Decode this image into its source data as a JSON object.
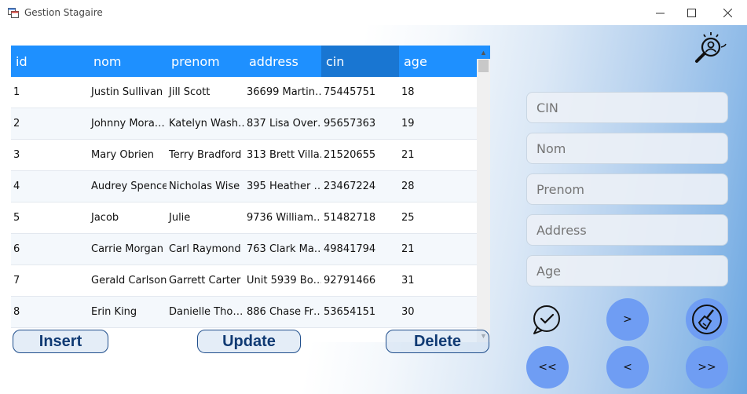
{
  "window": {
    "title": "Gestion Stagaire",
    "minimize_glyph": "—",
    "maximize_glyph": "☐",
    "close_glyph": "✕"
  },
  "grid": {
    "columns": [
      "id",
      "nom",
      "prenom",
      "address",
      "cin",
      "age"
    ],
    "rows": [
      [
        "1",
        "Justin Sullivan",
        "Jill Scott",
        "36699 Martin…",
        "75445751",
        "18"
      ],
      [
        "2",
        "Johnny Mora…",
        "Katelyn Wash…",
        "837 Lisa Over…",
        "95657363",
        "19"
      ],
      [
        "3",
        "Mary Obrien",
        "Terry Bradford",
        "313 Brett Villa…",
        "21520655",
        "21"
      ],
      [
        "4",
        "Audrey Spence",
        "Nicholas Wise",
        "395 Heather …",
        "23467224",
        "28"
      ],
      [
        "5",
        "Jacob",
        "Julie",
        "9736 William…",
        "51482718",
        "25"
      ],
      [
        "6",
        "Carrie Morgan",
        "Carl Raymond",
        "763 Clark Ma…",
        "49841794",
        "21"
      ],
      [
        "7",
        "Gerald Carlson",
        "Garrett Carter",
        "Unit 5939 Bo…",
        "92791466",
        "31"
      ],
      [
        "8",
        "Erin King",
        "Danielle Tho…",
        "886 Chase Fr…",
        "53654151",
        "30"
      ]
    ],
    "scroll_up_glyph": "▲",
    "scroll_down_glyph": "▼"
  },
  "actions": {
    "insert": "Insert",
    "update": "Update",
    "delete": "Delete"
  },
  "form": {
    "cin_placeholder": "CIN",
    "nom_placeholder": "Nom",
    "prenom_placeholder": "Prenom",
    "address_placeholder": "Address",
    "age_placeholder": "Age"
  },
  "nav": {
    "next": ">",
    "first": "<<",
    "previous": "<",
    "last": ">>"
  },
  "icons": {
    "search": "search-user-icon",
    "whatsapp": "chat-check-icon",
    "clear": "broom-icon"
  },
  "colors": {
    "header": "#1e90ff",
    "header_selected": "#1976d2",
    "nav_button": "#6f9df3",
    "action_text": "#103a73"
  }
}
